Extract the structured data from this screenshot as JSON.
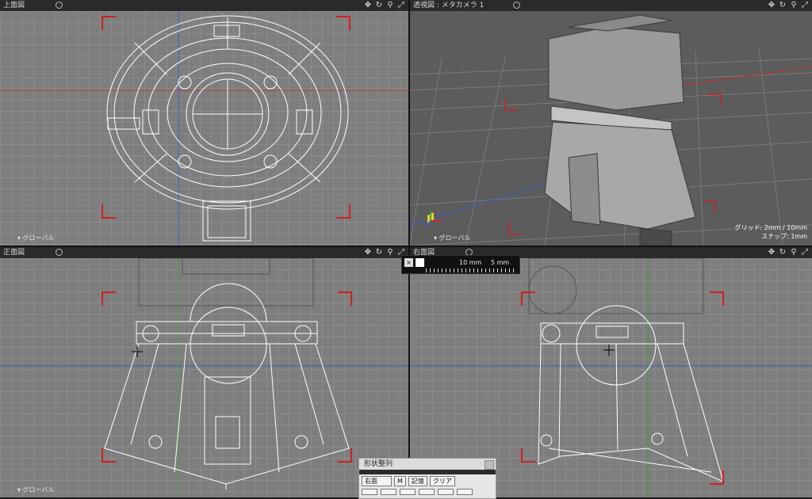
{
  "viewports": {
    "top": {
      "title": "上面図",
      "axis_label": "▾ グローバル"
    },
    "perspective": {
      "title": "透視図 : メタカメラ 1",
      "axis_label": "▾ グローバル",
      "grid_text": "グリッド: 2mm / 10mm",
      "snap_text": "スナップ: 1mm"
    },
    "front": {
      "title": "正面図",
      "axis_label": "▾ グローバル"
    },
    "right": {
      "title": "右面図",
      "axis_label": ""
    }
  },
  "toolbar_icons": [
    "move-icon",
    "rotate-icon",
    "zoom-icon",
    "fit-icon"
  ],
  "ruler": {
    "close_label": "×",
    "label_a": "10 mm",
    "label_b": "5 mm"
  },
  "palette": {
    "title": "形状整列",
    "view_select": "右面",
    "m_label": "M",
    "memory_button": "記憶",
    "clear_button": "クリア"
  },
  "colors": {
    "frame_mark": "#d21e1e",
    "wire": "#ffffff",
    "axis_x": "#c03030",
    "axis_y": "#3aa03a",
    "axis_z": "#3a5ac8"
  }
}
